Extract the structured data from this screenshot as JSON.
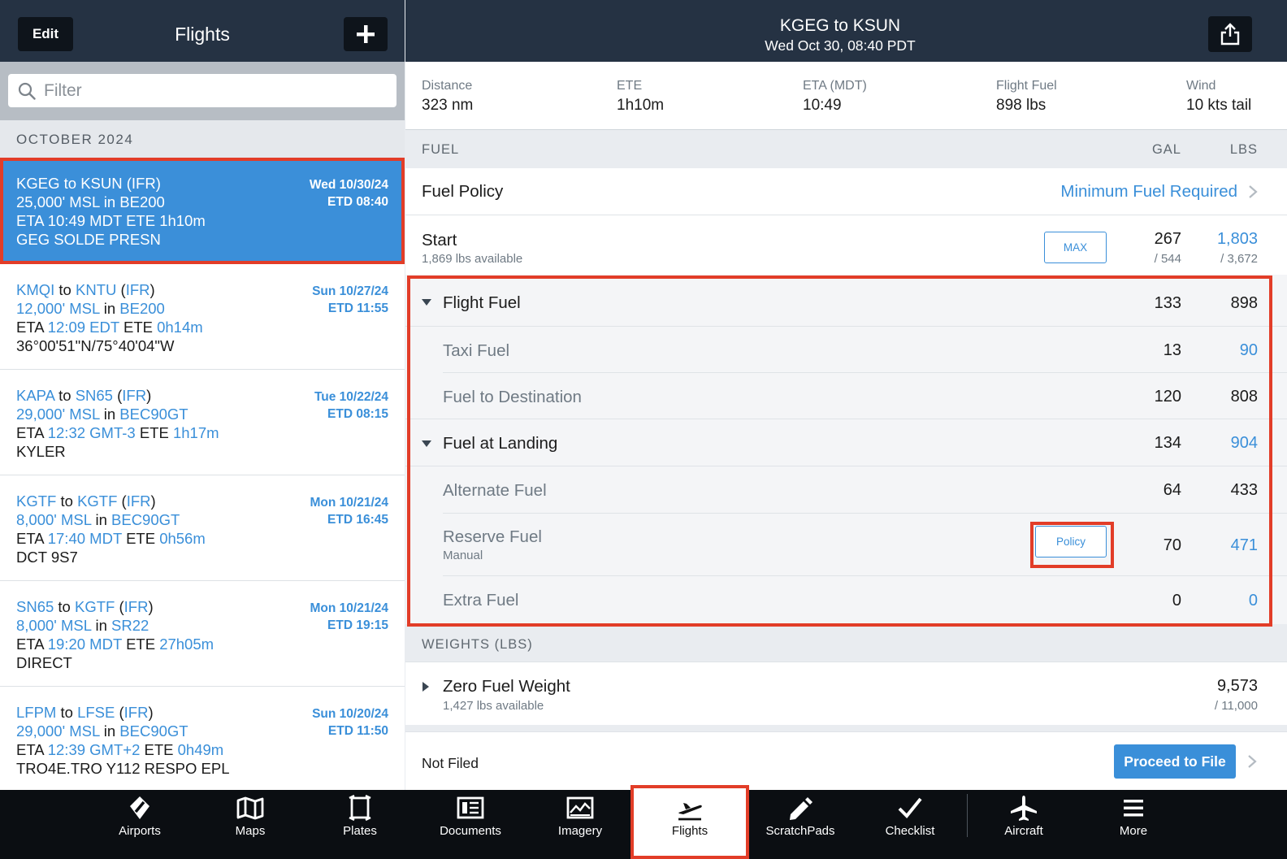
{
  "left": {
    "edit_label": "Edit",
    "title": "Flights",
    "filter_placeholder": "Filter",
    "month": "OCTOBER 2024",
    "flights": [
      {
        "from": "KGEG",
        "to": "KSUN",
        "rules": "IFR",
        "alt": "25,000' MSL",
        "aircraft": "BE200",
        "eta": "10:49 MDT",
        "ete": "1h10m",
        "route": "GEG SOLDE PRESN",
        "date": "Wed 10/30/24",
        "etd": "ETD 08:40"
      },
      {
        "from": "KMQI",
        "to": "KNTU",
        "rules": "IFR",
        "alt": "12,000' MSL",
        "aircraft": "BE200",
        "eta": "12:09 EDT",
        "ete": "0h14m",
        "route": "36°00'51\"N/75°40'04\"W",
        "date": "Sun 10/27/24",
        "etd": "ETD 11:55"
      },
      {
        "from": "KAPA",
        "to": "SN65",
        "rules": "IFR",
        "alt": "29,000' MSL",
        "aircraft": "BEC90GT",
        "eta": "12:32 GMT-3",
        "ete": "1h17m",
        "route": "KYLER",
        "date": "Tue 10/22/24",
        "etd": "ETD 08:15"
      },
      {
        "from": "KGTF",
        "to": "KGTF",
        "rules": "IFR",
        "alt": "8,000' MSL",
        "aircraft": "BEC90GT",
        "eta": "17:40 MDT",
        "ete": "0h56m",
        "route": "DCT 9S7",
        "date": "Mon 10/21/24",
        "etd": "ETD 16:45"
      },
      {
        "from": "SN65",
        "to": "KGTF",
        "rules": "IFR",
        "alt": "8,000' MSL",
        "aircraft": "SR22",
        "eta": "19:20 MDT",
        "ete": "27h05m",
        "route": "DIRECT",
        "date": "Mon 10/21/24",
        "etd": "ETD 19:15"
      },
      {
        "from": "LFPM",
        "to": "LFSE",
        "rules": "IFR",
        "alt": "29,000' MSL",
        "aircraft": "BEC90GT",
        "eta": "12:39 GMT+2",
        "ete": "0h49m",
        "route": "TRO4E.TRO Y112 RESPO EPL",
        "date": "Sun 10/20/24",
        "etd": "ETD 11:50"
      }
    ],
    "words": {
      "to": "to",
      "in": "in",
      "eta": "ETA",
      "ete": "ETE"
    }
  },
  "header": {
    "route": "KGEG to KSUN",
    "date": "Wed Oct 30, 08:40 PDT"
  },
  "summary": [
    {
      "label": "Distance",
      "value": "323 nm"
    },
    {
      "label": "ETE",
      "value": "1h10m"
    },
    {
      "label": "ETA (MDT)",
      "value": "10:49"
    },
    {
      "label": "Flight Fuel",
      "value": "898 lbs"
    },
    {
      "label": "Wind",
      "value": "10 kts tail"
    }
  ],
  "fuel": {
    "section": "FUEL",
    "col_gal": "GAL",
    "col_lbs": "LBS",
    "policy_label": "Fuel Policy",
    "policy_value": "Minimum Fuel Required",
    "start_label": "Start",
    "start_sub": "1,869 lbs available",
    "max_label": "MAX",
    "start_gal": "267",
    "start_gal_sub": "/ 544",
    "start_lbs": "1,803",
    "start_lbs_sub": "/ 3,672",
    "flight_fuel": {
      "label": "Flight Fuel",
      "gal": "133",
      "lbs": "898"
    },
    "taxi": {
      "label": "Taxi Fuel",
      "gal": "13",
      "lbs": "90"
    },
    "dest": {
      "label": "Fuel to Destination",
      "gal": "120",
      "lbs": "808"
    },
    "landing": {
      "label": "Fuel at Landing",
      "gal": "134",
      "lbs": "904"
    },
    "alternate": {
      "label": "Alternate Fuel",
      "gal": "64",
      "lbs": "433"
    },
    "reserve": {
      "label": "Reserve Fuel",
      "sub": "Manual",
      "policy_btn": "Policy",
      "gal": "70",
      "lbs": "471"
    },
    "extra": {
      "label": "Extra Fuel",
      "gal": "0",
      "lbs": "0"
    }
  },
  "weights": {
    "section": "WEIGHTS (LBS)",
    "zfw_label": "Zero Fuel Weight",
    "zfw_sub": "1,427 lbs available",
    "zfw_value": "9,573",
    "zfw_max": "/ 11,000"
  },
  "filing": {
    "status": "Not Filed",
    "proceed_label": "Proceed to File"
  },
  "tabs": [
    {
      "label": "Airports",
      "icon": "airports-icon"
    },
    {
      "label": "Maps",
      "icon": "maps-icon"
    },
    {
      "label": "Plates",
      "icon": "plates-icon"
    },
    {
      "label": "Documents",
      "icon": "documents-icon"
    },
    {
      "label": "Imagery",
      "icon": "imagery-icon"
    },
    {
      "label": "Flights",
      "icon": "flights-icon"
    },
    {
      "label": "ScratchPads",
      "icon": "scratchpads-icon"
    },
    {
      "label": "Checklist",
      "icon": "checklist-icon"
    },
    {
      "label": "Aircraft",
      "icon": "aircraft-icon"
    },
    {
      "label": "More",
      "icon": "more-icon"
    }
  ],
  "colors": {
    "accent": "#3a8fd9",
    "header": "#253243",
    "highlight": "#e23d28",
    "tabbar": "#0b0e12"
  }
}
